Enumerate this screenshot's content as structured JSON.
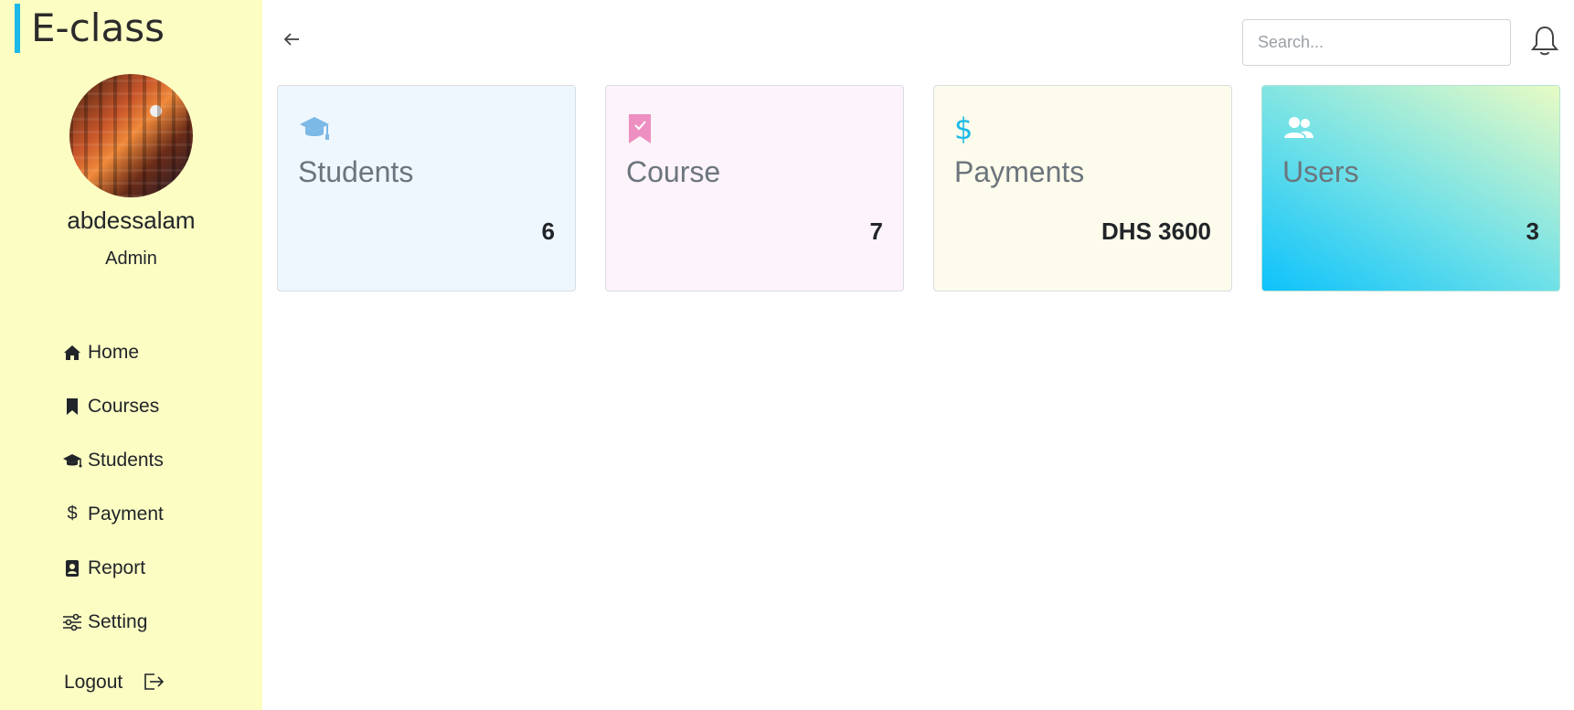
{
  "app": {
    "title": "E-class"
  },
  "profile": {
    "name": "abdessalam",
    "role": "Admin"
  },
  "sidebar": {
    "items": [
      {
        "label": "Home",
        "icon": "home-icon"
      },
      {
        "label": "Courses",
        "icon": "bookmark-icon"
      },
      {
        "label": "Students",
        "icon": "graduation-cap-icon"
      },
      {
        "label": "Payment",
        "icon": "dollar-icon"
      },
      {
        "label": "Report",
        "icon": "report-icon"
      },
      {
        "label": "Setting",
        "icon": "sliders-icon"
      }
    ],
    "logout_label": "Logout"
  },
  "header": {
    "search_placeholder": "Search..."
  },
  "cards": [
    {
      "title": "Students",
      "value": "6",
      "icon": "graduation-cap-icon",
      "icon_color": "#7cb9e6"
    },
    {
      "title": "Course",
      "value": "7",
      "icon": "bookmark-check-icon",
      "icon_color": "#ee8fc2"
    },
    {
      "title": "Payments",
      "value": "DHS 3600",
      "icon": "dollar-icon",
      "icon_color": "#1bb9e8"
    },
    {
      "title": "Users",
      "value": "3",
      "icon": "users-icon",
      "icon_color": "#ffffff"
    }
  ],
  "colors": {
    "sidebar_bg": "#fcfdc3",
    "brand_accent": "#1bb9e8"
  }
}
